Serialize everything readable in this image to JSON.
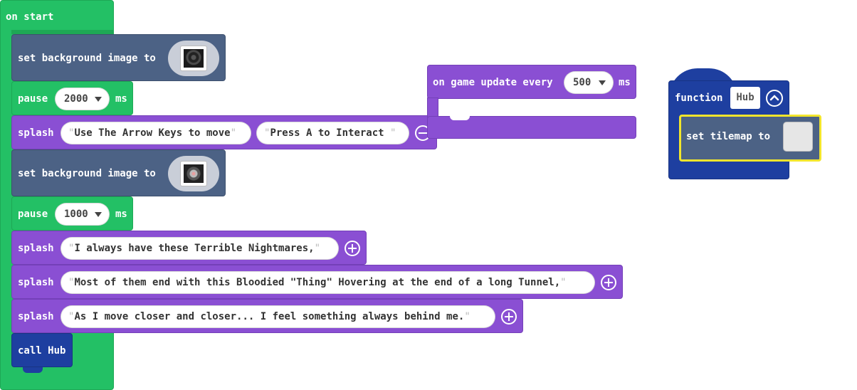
{
  "on_start": {
    "label": "on start",
    "blocks": [
      {
        "kind": "set-bg",
        "label": "set background image to",
        "image": "dark-swirl"
      },
      {
        "kind": "pause",
        "label": "pause",
        "value": "2000",
        "unit": "ms"
      },
      {
        "kind": "splash",
        "label": "splash",
        "text1": "Use The Arrow Keys to move",
        "text2": "Press A to Interact "
      },
      {
        "kind": "set-bg",
        "label": "set background image to",
        "image": "dark-eye"
      },
      {
        "kind": "pause",
        "label": "pause",
        "value": "1000",
        "unit": "ms"
      },
      {
        "kind": "splash",
        "label": "splash",
        "text1": "I always have these Terrible Nightmares,"
      },
      {
        "kind": "splash",
        "label": "splash",
        "text1": "Most of them end with this Bloodied \"Thing\" Hovering at the end of a long Tunnel,"
      },
      {
        "kind": "splash",
        "label": "splash",
        "text1": "As I move closer and closer... I feel something always behind me."
      },
      {
        "kind": "call",
        "label": "call Hub"
      }
    ]
  },
  "game_update": {
    "label": "on game update every",
    "value": "500",
    "unit": "ms"
  },
  "function_block": {
    "label": "function",
    "name": "Hub",
    "inner_label": "set tilemap to"
  },
  "quote": "\"",
  "colors": {
    "loops": "#23c065",
    "game": "#8a4fd3",
    "scene": "#4c6285",
    "functions": "#1e3fa0",
    "highlight": "#f2e52c"
  }
}
